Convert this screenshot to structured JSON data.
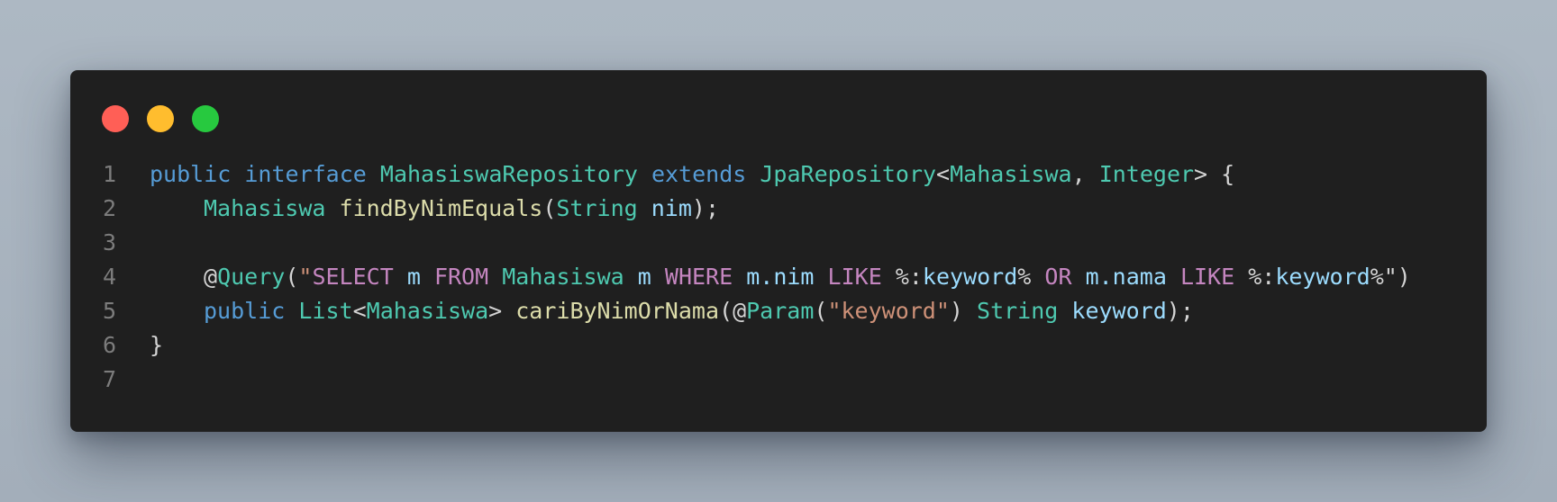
{
  "window": {
    "traffic_lights": {
      "close": "#ff5f56",
      "minimize": "#ffbd2e",
      "maximize": "#27c93f"
    }
  },
  "code": {
    "line_numbers": [
      "1",
      "2",
      "3",
      "4",
      "5",
      "6",
      "7"
    ],
    "lines": [
      {
        "indent": 0,
        "tokens": [
          {
            "t": "public",
            "c": "kw"
          },
          {
            "t": " ",
            "c": "p"
          },
          {
            "t": "interface",
            "c": "kw"
          },
          {
            "t": " ",
            "c": "p"
          },
          {
            "t": "MahasiswaRepository",
            "c": "ty"
          },
          {
            "t": " ",
            "c": "p"
          },
          {
            "t": "extends",
            "c": "kw"
          },
          {
            "t": " ",
            "c": "p"
          },
          {
            "t": "JpaRepository",
            "c": "ty"
          },
          {
            "t": "<",
            "c": "p"
          },
          {
            "t": "Mahasiswa",
            "c": "ty"
          },
          {
            "t": ", ",
            "c": "p"
          },
          {
            "t": "Integer",
            "c": "ty"
          },
          {
            "t": "> {",
            "c": "p"
          }
        ]
      },
      {
        "indent": 1,
        "tokens": [
          {
            "t": "Mahasiswa",
            "c": "ty"
          },
          {
            "t": " ",
            "c": "p"
          },
          {
            "t": "findByNimEquals",
            "c": "fn"
          },
          {
            "t": "(",
            "c": "p"
          },
          {
            "t": "String",
            "c": "ty"
          },
          {
            "t": " ",
            "c": "p"
          },
          {
            "t": "nim",
            "c": "var"
          },
          {
            "t": ");",
            "c": "p"
          }
        ]
      },
      {
        "indent": 0,
        "tokens": []
      },
      {
        "indent": 1,
        "tokens": [
          {
            "t": "@",
            "c": "p"
          },
          {
            "t": "Query",
            "c": "ty"
          },
          {
            "t": "(",
            "c": "p"
          },
          {
            "t": "\"",
            "c": "str"
          },
          {
            "t": "SELECT",
            "c": "sqlkw"
          },
          {
            "t": " ",
            "c": "p"
          },
          {
            "t": "m",
            "c": "var"
          },
          {
            "t": " ",
            "c": "p"
          },
          {
            "t": "FROM",
            "c": "sqlkw"
          },
          {
            "t": " ",
            "c": "p"
          },
          {
            "t": "Mahasiswa",
            "c": "ty"
          },
          {
            "t": " ",
            "c": "p"
          },
          {
            "t": "m",
            "c": "var"
          },
          {
            "t": " ",
            "c": "p"
          },
          {
            "t": "WHERE",
            "c": "sqlkw"
          },
          {
            "t": " ",
            "c": "p"
          },
          {
            "t": "m.nim",
            "c": "var"
          },
          {
            "t": " ",
            "c": "p"
          },
          {
            "t": "LIKE",
            "c": "sqlkw"
          },
          {
            "t": " %:",
            "c": "p"
          },
          {
            "t": "keyword",
            "c": "var"
          },
          {
            "t": "%",
            "c": "p"
          },
          {
            "t": " ",
            "c": "p"
          },
          {
            "t": "OR",
            "c": "sqlkw"
          },
          {
            "t": " ",
            "c": "p"
          },
          {
            "t": "m.nama",
            "c": "var"
          },
          {
            "t": " ",
            "c": "p"
          },
          {
            "t": "LIKE",
            "c": "sqlkw"
          },
          {
            "t": " %:",
            "c": "p"
          },
          {
            "t": "keyword",
            "c": "var"
          },
          {
            "t": "%\")",
            "c": "p"
          }
        ]
      },
      {
        "indent": 1,
        "tokens": [
          {
            "t": "public",
            "c": "kw"
          },
          {
            "t": " ",
            "c": "p"
          },
          {
            "t": "List",
            "c": "ty"
          },
          {
            "t": "<",
            "c": "p"
          },
          {
            "t": "Mahasiswa",
            "c": "ty"
          },
          {
            "t": "> ",
            "c": "p"
          },
          {
            "t": "cariByNimOrNama",
            "c": "fn"
          },
          {
            "t": "(@",
            "c": "p"
          },
          {
            "t": "Param",
            "c": "ty"
          },
          {
            "t": "(",
            "c": "p"
          },
          {
            "t": "\"keyword\"",
            "c": "str"
          },
          {
            "t": ") ",
            "c": "p"
          },
          {
            "t": "String",
            "c": "ty"
          },
          {
            "t": " ",
            "c": "p"
          },
          {
            "t": "keyword",
            "c": "var"
          },
          {
            "t": ");",
            "c": "p"
          }
        ]
      },
      {
        "indent": 0,
        "tokens": [
          {
            "t": "}",
            "c": "p"
          }
        ]
      },
      {
        "indent": 0,
        "tokens": []
      }
    ]
  }
}
